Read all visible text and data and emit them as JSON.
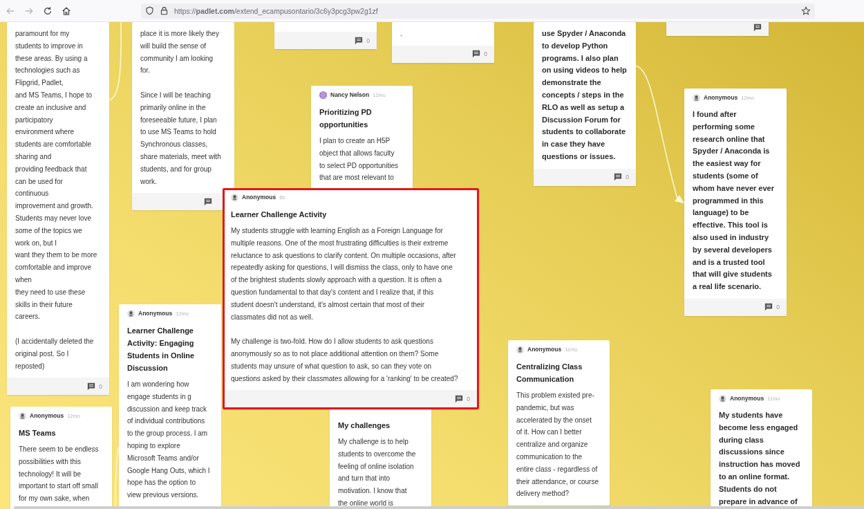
{
  "browser": {
    "url": "https://**padlet.com**/extend_ecampusontario/3c6y3pcg3pw2g1zf"
  },
  "posts": [
    {
      "kind": "normal",
      "body": [
        "paramount for my\nstudents to improve in\nthese areas. By using a\ntechnologies such as\nFlipgrid, Padlet,\nand MS Teams, I hope to\ncreate an inclusive and\nparticipatory\nenvironment where\nstudents are comfortable\nsharing and\nproviding feedback that\ncan be used for\ncontinuous\nimprovement and growth.\nStudents may never love\nsome of the topics we\nwork on, but I\nwant they them to be more\ncomfortable and improve\nwhen\nthey need to use these\nskills in their future\ncareers.",
        "(I accidentally deleted the\noriginal post. So I\nreposted)"
      ],
      "footer": true,
      "comments": "0",
      "highlighted": false
    },
    {
      "avatar": {
        "kind": "anonymous"
      },
      "author": "Anonymous",
      "time": "12mo",
      "title": "MS Teams",
      "kind": "normal",
      "body": [
        "There seem to be endless\npossibilities with this\ntechnology! It will be\nimportant to start off small\nfor my own sake, when"
      ],
      "footer": false,
      "highlighted": false
    },
    {
      "kind": "normal",
      "body": [
        "place it is more likely they\nwill build the sense of\ncommunity I am looking\nfor.",
        "Since I will be teaching\nprimarily online in the\nforeseeable future, I plan\nto use MS Teams to hold\nSynchronous classes,\nshare materials, meet with\nstudents, and for group\nwork."
      ],
      "footer": true,
      "highlighted": false
    },
    {
      "avatar": {
        "kind": "anonymous"
      },
      "author": "Anonymous",
      "time": "12mo",
      "title": "Learner Challenge\nActivity: Engaging\nStudents in Online\nDiscussion",
      "kind": "normal",
      "body": [
        "I am wondering how\nengage students in g\ndiscussion and keep track\nof individual contributions\nto the group process. I am\nhoping to explore\nMicrosoft Teams and/or\nGoogle Hang Outs, which I\nhope has the option to\nview previous versions."
      ],
      "footer": false,
      "highlighted": false
    },
    {
      "avatar": {
        "kind": "anonymous"
      },
      "author": "Anonymous",
      "time": "6h",
      "title": "Learner Challenge Activity",
      "kind": "normal",
      "body": [
        "My students struggle with learning English as a Foreign Language for\nmultiple reasons. One of the most frustrating difficulties is their extreme\nreluctance to ask questions to clarify content. On multiple occasions, after\nrepeatedly asking for questions, I will dismiss the class, only to have one\nof the brightest students slowly approach with a question. It is often a\nquestion fundamental to that day's content and I realize that, if this\nstudent doesn't understand, it's almost certain that most of their\nclassmates did not as well.",
        "My challenge is two-fold. How do I allow students to ask questions\nanonymously so as to not place additional attention on them? Some\nstudents may unsure of what question to ask, so can they vote on\nquestions asked by their classmates allowing for a 'ranking' to be created?"
      ],
      "footer": true,
      "comments": "0",
      "highlighted": true
    },
    {
      "footer": true,
      "comments": "0",
      "highlighted": false
    },
    {
      "avatar": {
        "kind": "globe",
        "color": "#9b6fc9"
      },
      "author": "Nancy Nelson",
      "time": "12mo",
      "title": "Prioritizing PD\nopportunities",
      "kind": "normal",
      "body": [
        "I plan to create an H5P\nobject that allows faculty\nto select PD opportunities\nthat are most relevant to"
      ],
      "footer": false,
      "highlighted": false
    },
    {
      "title": "My challenges",
      "kind": "normal",
      "body": [
        "My challenge is to help\nstudents to overcome the\nfeeling of online isolation\nand turn that into\nmotivation.  I know that\nthe online world is"
      ],
      "footer": false,
      "highlighted": false
    },
    {
      "kind": "normal",
      "body": [
        "."
      ],
      "footer": true,
      "comments": "0",
      "highlighted": false
    },
    {
      "avatar": {
        "kind": "anonymous"
      },
      "author": "Anonymous",
      "time": "11mo",
      "title": "Centralizing Class\nCommunication",
      "kind": "normal",
      "body": [
        "This problem existed pre-\npandemic, but was\naccelerated by the onset\nof it. How can I better\ncentralize and organize\ncommunication to the\nentire class - regardless of\ntheir attendance, or course\ndelivery method?"
      ],
      "footer": false,
      "highlighted": false
    },
    {
      "kind": "large",
      "body": [
        "use Spyder / Anaconda\nto develop Python\nprograms.  I also plan\non using videos to help\ndemonstrate the\nconcepts / steps in the\nRLO as well as setup a\nDiscussion Forum for\nstudents to collaborate\nin case they have\nquestions or issues."
      ],
      "footer": true,
      "comments": "0",
      "highlighted": false
    },
    {
      "footer": true,
      "highlighted": false
    },
    {
      "avatar": {
        "kind": "anonymous"
      },
      "author": "Anonymous",
      "time": "12mo",
      "kind": "large",
      "body": [
        "I found after\nperforming some\nresearch online that\nSpyder / Anaconda is\nthe easiest way for\nstudents (some of\nwhom have never ever\nprogrammed in this\nlanguage) to be\neffective.  This tool is\nalso used in industry\nby several developers\nand is a trusted tool\nthat will give students\na real life scenario."
      ],
      "footer": true,
      "comments": "0",
      "highlighted": false
    },
    {
      "avatar": {
        "kind": "anonymous"
      },
      "author": "Anonymous",
      "time": "11mo",
      "kind": "large",
      "body": [
        "My students have\nbecome less engaged\nduring class\ndiscussions  since\ninstruction has moved\nto an online format.\nStudents do not\nprepare in advance of"
      ],
      "footer": false,
      "highlighted": false
    }
  ]
}
